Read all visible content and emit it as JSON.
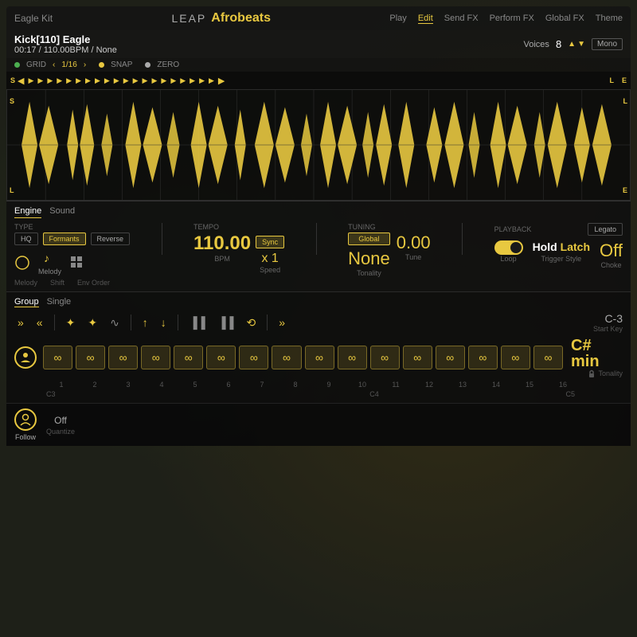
{
  "header": {
    "kit_name": "Eagle Kit",
    "logo": "LEAP",
    "app_name": "Afrobeats",
    "nav_items": [
      "Play",
      "Edit",
      "Send FX",
      "Perform FX",
      "Global FX",
      "Theme"
    ],
    "active_nav": "Edit"
  },
  "track": {
    "name": "Kick[110] Eagle",
    "time": "00:17",
    "bpm": "110.00BPM",
    "key": "None",
    "voices_label": "Voices",
    "voices_value": "8",
    "mono_label": "Mono"
  },
  "grid": {
    "label": "GRID",
    "value": "1/16",
    "snap_label": "SNAP",
    "zero_label": "ZERO"
  },
  "waveform": {
    "s_label": "S",
    "l_label": "L",
    "e_label": "E"
  },
  "engine": {
    "tabs": [
      "Engine",
      "Sound"
    ],
    "active_tab": "Engine",
    "type_label": "TYPE",
    "hq_label": "HQ",
    "formants_label": "Formants",
    "reverse_label": "Reverse",
    "tempo_label": "TEMPO",
    "sync_label": "Sync",
    "bpm_value": "110.00",
    "bpm_unit": "BPM",
    "speed_value": "x 1",
    "speed_label": "Speed",
    "tuning_label": "TUNING",
    "global_label": "Global",
    "tonality_value": "None",
    "tonality_label": "Tonality",
    "tune_value": "0.00",
    "tune_label": "Tune",
    "playback_label": "PLAYBACK",
    "loop_label": "Loop",
    "hold_label": "Hold",
    "latch_label": "Latch",
    "trigger_label": "Trigger Style",
    "choke_value": "Off",
    "choke_label": "Choke",
    "legato_label": "Legato",
    "icons": [
      {
        "id": "circle",
        "label": ""
      },
      {
        "id": "melody",
        "label": "Melody"
      },
      {
        "id": "grid",
        "label": ""
      },
      {
        "id": "shift",
        "label": "Shift"
      },
      {
        "id": "env-order",
        "label": "Env Order"
      }
    ]
  },
  "group": {
    "tabs": [
      "Group",
      "Single"
    ],
    "active_tab": "Group",
    "controls": [
      "»",
      "«",
      "✦",
      "✦",
      "∿",
      "↑",
      "↓",
      "▐▐",
      "▐▐",
      "⟲",
      "»"
    ],
    "pads": [
      1,
      2,
      3,
      4,
      5,
      6,
      7,
      8,
      9,
      10,
      11,
      12,
      13,
      14,
      15,
      16
    ],
    "c3_label": "C3",
    "c4_label": "C4",
    "c5_label": "C5",
    "start_key": "C-3",
    "start_key_label": "Start Key",
    "tonality": "C# min",
    "tonality_label": "Tonality"
  },
  "bottom": {
    "follow_label": "Follow",
    "quantize_value": "Off",
    "quantize_label": "Quantize"
  },
  "colors": {
    "accent": "#e8c840",
    "bg": "#1a1a1a",
    "text_primary": "#ffffff",
    "text_secondary": "#888888"
  }
}
